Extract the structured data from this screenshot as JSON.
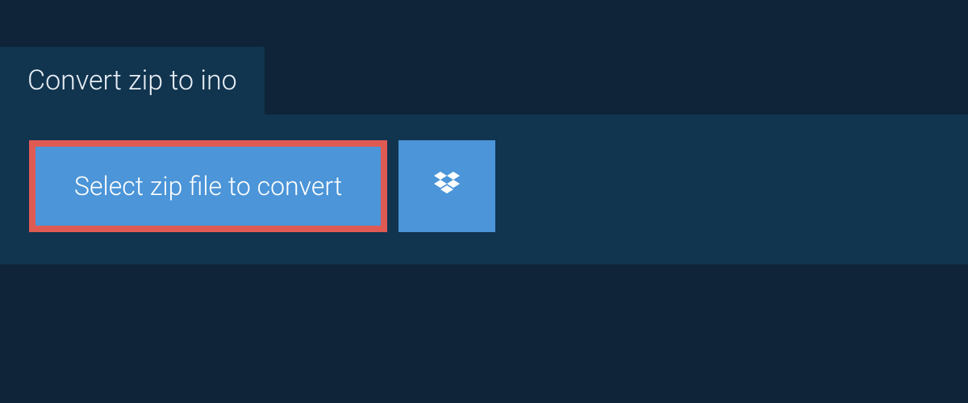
{
  "header": {
    "title": "Convert zip to ino"
  },
  "actions": {
    "select_label": "Select zip file to convert",
    "dropbox_icon": "dropbox-icon"
  },
  "colors": {
    "page_bg": "#0f2438",
    "panel_bg": "#11344f",
    "button_bg": "#4b95d8",
    "highlight_border": "#e05a54",
    "text_light": "#e8eef4",
    "text_white": "#ffffff"
  }
}
